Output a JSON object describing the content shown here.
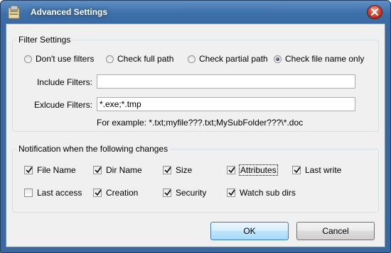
{
  "window": {
    "title": "Advanced Settings"
  },
  "filter": {
    "group_label": "Filter Settings",
    "options": [
      {
        "label": "Don't use filters",
        "selected": false
      },
      {
        "label": "Check full path",
        "selected": false
      },
      {
        "label": "Check partial path",
        "selected": false
      },
      {
        "label": "Check file name only",
        "selected": true
      }
    ],
    "include_label": "Include Filters:",
    "include_value": "",
    "exclude_label": "Exlcude Filters:",
    "exclude_value": "*.exe;*.tmp",
    "example": "For example: *.txt;myfile???.txt;MySubFolder???\\*.doc"
  },
  "notify": {
    "group_label": "Notification when the following changes",
    "items": [
      {
        "label": "File Name",
        "checked": true
      },
      {
        "label": "Dir Name",
        "checked": true
      },
      {
        "label": "Size",
        "checked": true
      },
      {
        "label": "Attributes",
        "checked": true
      },
      {
        "label": "Last write",
        "checked": true
      },
      {
        "label": "Last access",
        "checked": false
      },
      {
        "label": "Creation",
        "checked": true
      },
      {
        "label": "Security",
        "checked": true
      },
      {
        "label": "Watch sub dirs",
        "checked": true
      }
    ]
  },
  "buttons": {
    "ok": "OK",
    "cancel": "Cancel"
  }
}
